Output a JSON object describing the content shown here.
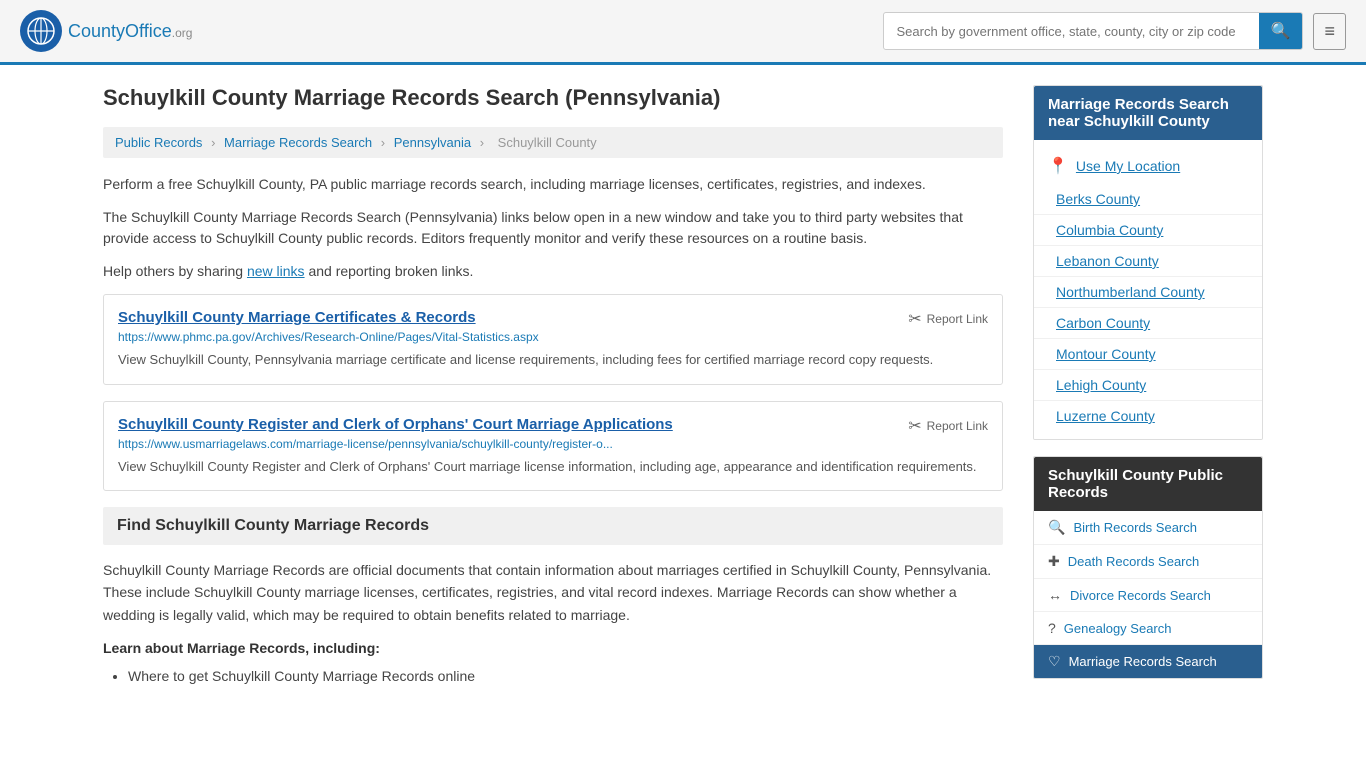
{
  "header": {
    "logo_icon": "🌐",
    "logo_brand": "CountyOffice",
    "logo_org": ".org",
    "search_placeholder": "Search by government office, state, county, city or zip code",
    "search_btn_icon": "🔍",
    "menu_icon": "≡"
  },
  "page": {
    "title": "Schuylkill County Marriage Records Search (Pennsylvania)",
    "breadcrumb": {
      "items": [
        "Public Records",
        "Marriage Records Search",
        "Pennsylvania",
        "Schuylkill County"
      ]
    },
    "description1": "Perform a free Schuylkill County, PA public marriage records search, including marriage licenses, certificates, registries, and indexes.",
    "description2": "The Schuylkill County Marriage Records Search (Pennsylvania) links below open in a new window and take you to third party websites that provide access to Schuylkill County public records. Editors frequently monitor and verify these resources on a routine basis.",
    "description3_prefix": "Help others by sharing ",
    "description3_link": "new links",
    "description3_suffix": " and reporting broken links.",
    "resources": [
      {
        "title": "Schuylkill County Marriage Certificates & Records",
        "url": "https://www.phmc.pa.gov/Archives/Research-Online/Pages/Vital-Statistics.aspx",
        "desc": "View Schuylkill County, Pennsylvania marriage certificate and license requirements, including fees for certified marriage record copy requests.",
        "report_label": "Report Link"
      },
      {
        "title": "Schuylkill County Register and Clerk of Orphans' Court Marriage Applications",
        "url": "https://www.usmarriagelaws.com/marriage-license/pennsylvania/schuylkill-county/register-o...",
        "desc": "View Schuylkill County Register and Clerk of Orphans' Court marriage license information, including age, appearance and identification requirements.",
        "report_label": "Report Link"
      }
    ],
    "section_heading": "Find Schuylkill County Marriage Records",
    "body_text": "Schuylkill County Marriage Records are official documents that contain information about marriages certified in Schuylkill County, Pennsylvania. These include Schuylkill County marriage licenses, certificates, registries, and vital record indexes. Marriage Records can show whether a wedding is legally valid, which may be required to obtain benefits related to marriage.",
    "sub_heading": "Learn about Marriage Records, including:",
    "bullets": [
      "Where to get Schuylkill County Marriage Records online"
    ]
  },
  "sidebar": {
    "nearby_title": "Marriage Records Search near Schuylkill County",
    "use_location_label": "Use My Location",
    "nearby_counties": [
      {
        "name": "Berks County",
        "icon": ""
      },
      {
        "name": "Columbia County",
        "icon": ""
      },
      {
        "name": "Lebanon County",
        "icon": ""
      },
      {
        "name": "Northumberland County",
        "icon": ""
      },
      {
        "name": "Carbon County",
        "icon": ""
      },
      {
        "name": "Montour County",
        "icon": ""
      },
      {
        "name": "Lehigh County",
        "icon": ""
      },
      {
        "name": "Luzerne County",
        "icon": ""
      }
    ],
    "public_records_title": "Schuylkill County Public Records",
    "public_records_links": [
      {
        "name": "Birth Records Search",
        "icon": "🔍",
        "active": false
      },
      {
        "name": "Death Records Search",
        "icon": "+",
        "active": false
      },
      {
        "name": "Divorce Records Search",
        "icon": "↔",
        "active": false
      },
      {
        "name": "Genealogy Search",
        "icon": "?",
        "active": false
      },
      {
        "name": "Marriage Records Search",
        "icon": "♡",
        "active": true
      }
    ]
  }
}
